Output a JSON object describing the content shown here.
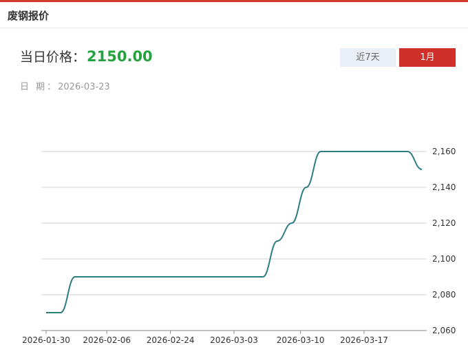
{
  "header": {
    "title": "废钢报价"
  },
  "price": {
    "label": "当日价格：",
    "value": "2150.00"
  },
  "date": {
    "label": "日 期：",
    "value": "2026-03-23"
  },
  "tabs": [
    {
      "label": "近7天",
      "active": false
    },
    {
      "label": "1月",
      "active": true
    }
  ],
  "colors": {
    "accent": "#d0302a",
    "price": "#22a33d",
    "line": "#2e7d7f"
  },
  "chart_data": {
    "type": "line",
    "title": "",
    "xlabel": "",
    "ylabel": "",
    "ylim": [
      2060,
      2160
    ],
    "yticks": [
      2060,
      2080,
      2100,
      2120,
      2140,
      2160
    ],
    "ytick_labels": [
      "2,060",
      "2,080",
      "2,100",
      "2,120",
      "2,140",
      "2,160"
    ],
    "xticks": [
      "2026-01-30",
      "2026-02-06",
      "2026-02-24",
      "2026-03-03",
      "2026-03-10",
      "2026-03-17"
    ],
    "grid": true,
    "series": [
      {
        "values": [
          2070,
          2070,
          2090,
          2090,
          2090,
          2090,
          2090,
          2090,
          2090,
          2090,
          2090,
          2090,
          2090,
          2090,
          2090,
          2090,
          2110,
          2120,
          2140,
          2160,
          2160,
          2160,
          2160,
          2160,
          2160,
          2160,
          2150
        ]
      }
    ]
  }
}
